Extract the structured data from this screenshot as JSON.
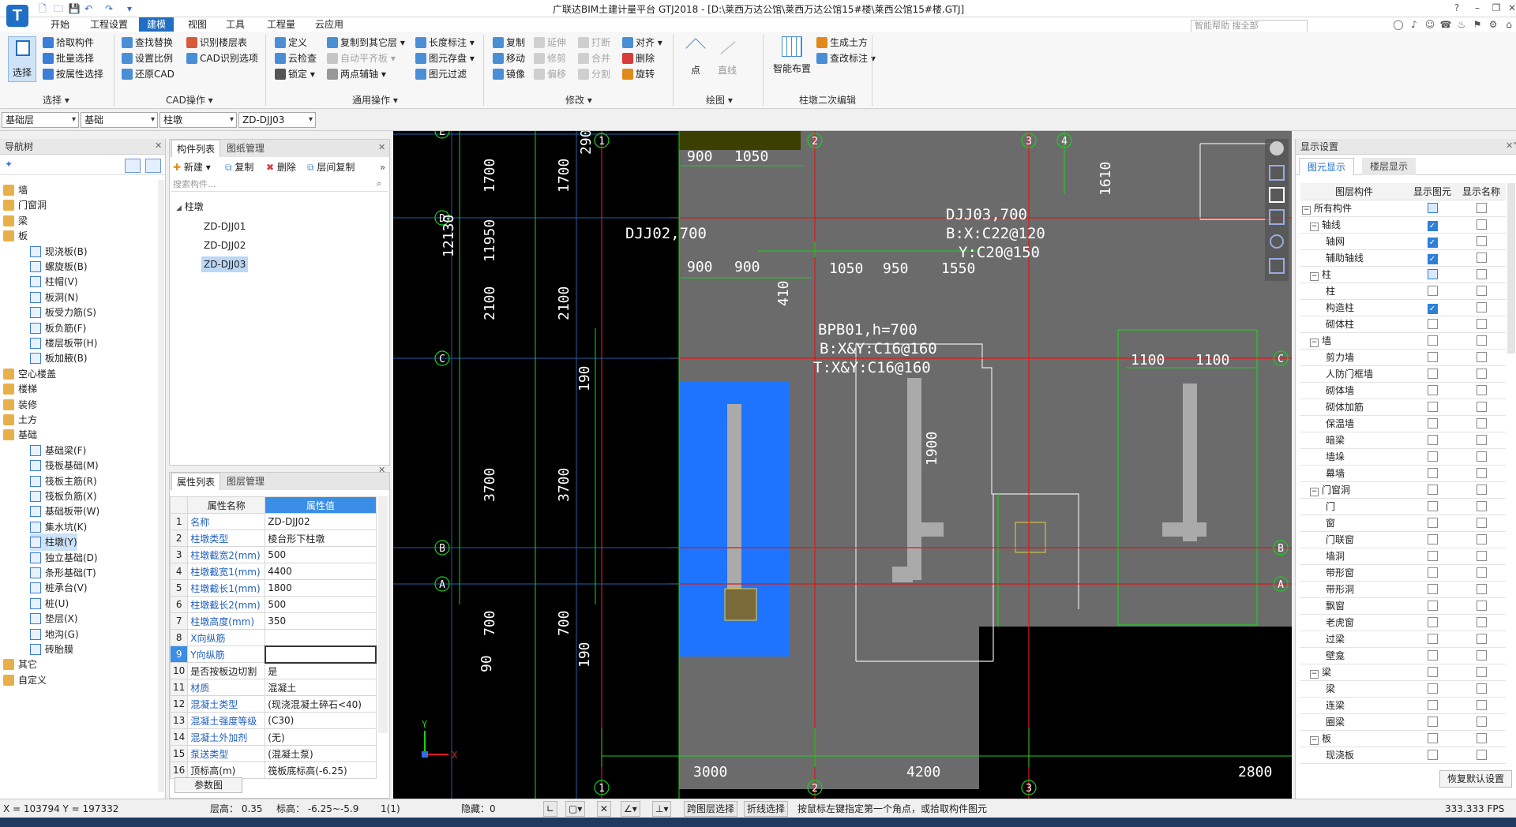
{
  "app": {
    "logo": "T",
    "title": "广联达BIM土建计量平台 GTJ2018 - [D:\\莱西万达公馆\\莱西万达公馆15#楼\\莱西公馆15#楼.GTJ]"
  },
  "menu": {
    "tabs": [
      "开始",
      "工程设置",
      "建模",
      "视图",
      "工具",
      "工程量",
      "云应用"
    ],
    "active_tab": "建模",
    "search_placeholder": "智能帮助 搜全部"
  },
  "ribbon": {
    "select": {
      "big_label": "选择",
      "items": [
        "拾取构件",
        "批量选择",
        "按属性选择"
      ],
      "group": "选择"
    },
    "cad": {
      "items": [
        "查找替换",
        "识别楼层表",
        "设置比例",
        "CAD识别选项",
        "还原CAD"
      ],
      "group": "CAD操作"
    },
    "common": {
      "items": [
        "定义",
        "复制到其它层",
        "长度标注",
        "云检查",
        "自动平齐板",
        "图元存盘",
        "锁定",
        "两点辅轴",
        "图元过滤"
      ],
      "group": "通用操作"
    },
    "modify": {
      "items": [
        "复制",
        "延伸",
        "打断",
        "对齐",
        "移动",
        "修剪",
        "合并",
        "删除",
        "镜像",
        "偏移",
        "分割",
        "旋转"
      ],
      "group": "修改"
    },
    "draw": {
      "items": [
        "点",
        "直线"
      ],
      "group": "绘图"
    },
    "smart": {
      "big_label": "智能布置",
      "items": [
        "生成土方",
        "查改标注"
      ],
      "group": "柱墩二次编辑"
    }
  },
  "selectors": [
    "基础层",
    "基础",
    "柱墩",
    "ZD-DJJ03"
  ],
  "nav": {
    "title": "导航树",
    "items": [
      {
        "label": "墙",
        "type": "folder"
      },
      {
        "label": "门窗洞",
        "type": "folder"
      },
      {
        "label": "梁",
        "type": "folder"
      },
      {
        "label": "板",
        "type": "folder-open"
      },
      {
        "label": "现浇板(B)",
        "type": "child"
      },
      {
        "label": "螺旋板(B)",
        "type": "child"
      },
      {
        "label": "柱帽(V)",
        "type": "child"
      },
      {
        "label": "板洞(N)",
        "type": "child"
      },
      {
        "label": "板受力筋(S)",
        "type": "child"
      },
      {
        "label": "板负筋(F)",
        "type": "child"
      },
      {
        "label": "楼层板带(H)",
        "type": "child"
      },
      {
        "label": "板加腋(B)",
        "type": "child"
      },
      {
        "label": "空心楼盖",
        "type": "folder"
      },
      {
        "label": "楼梯",
        "type": "folder"
      },
      {
        "label": "装修",
        "type": "folder"
      },
      {
        "label": "土方",
        "type": "folder"
      },
      {
        "label": "基础",
        "type": "folder-open"
      },
      {
        "label": "基础梁(F)",
        "type": "child"
      },
      {
        "label": "筏板基础(M)",
        "type": "child"
      },
      {
        "label": "筏板主筋(R)",
        "type": "child"
      },
      {
        "label": "筏板负筋(X)",
        "type": "child"
      },
      {
        "label": "基础板带(W)",
        "type": "child"
      },
      {
        "label": "集水坑(K)",
        "type": "child"
      },
      {
        "label": "柱墩(Y)",
        "type": "child-selected"
      },
      {
        "label": "独立基础(D)",
        "type": "child"
      },
      {
        "label": "条形基础(T)",
        "type": "child"
      },
      {
        "label": "桩承台(V)",
        "type": "child"
      },
      {
        "label": "桩(U)",
        "type": "child"
      },
      {
        "label": "垫层(X)",
        "type": "child"
      },
      {
        "label": "地沟(G)",
        "type": "child"
      },
      {
        "label": "砖胎膜",
        "type": "child"
      },
      {
        "label": "其它",
        "type": "folder"
      },
      {
        "label": "自定义",
        "type": "folder"
      }
    ]
  },
  "components": {
    "tabs": [
      "构件列表",
      "图纸管理"
    ],
    "actions": [
      "新建",
      "复制",
      "删除",
      "层间复制"
    ],
    "search_placeholder": "搜索构件...",
    "root": "柱墩",
    "items": [
      "ZD-DJJ01",
      "ZD-DJJ02",
      "ZD-DJJ03"
    ],
    "selected": "ZD-DJJ03"
  },
  "properties": {
    "tabs": [
      "属性列表",
      "图层管理"
    ],
    "headers": [
      "属性名称",
      "属性值"
    ],
    "rows": [
      {
        "n": "1",
        "name": "名称",
        "value": "ZD-DJJ02",
        "blue": true
      },
      {
        "n": "2",
        "name": "柱墩类型",
        "value": "棱台形下柱墩",
        "blue": true
      },
      {
        "n": "3",
        "name": "柱墩截宽2(mm)",
        "value": "500",
        "blue": true
      },
      {
        "n": "4",
        "name": "柱墩截宽1(mm)",
        "value": "4400",
        "blue": true
      },
      {
        "n": "5",
        "name": "柱墩截长1(mm)",
        "value": "1800",
        "blue": true
      },
      {
        "n": "6",
        "name": "柱墩截长2(mm)",
        "value": "500",
        "blue": true
      },
      {
        "n": "7",
        "name": "柱墩高度(mm)",
        "value": "350",
        "blue": true
      },
      {
        "n": "8",
        "name": "X向纵筋",
        "value": "",
        "blue": true
      },
      {
        "n": "9",
        "name": "Y向纵筋",
        "value": "",
        "blue": true
      },
      {
        "n": "10",
        "name": "是否按板边切割",
        "value": "是",
        "blue": false
      },
      {
        "n": "11",
        "name": "材质",
        "value": "混凝土",
        "blue": true
      },
      {
        "n": "12",
        "name": "混凝土类型",
        "value": "(现浇混凝土碎石<40)",
        "blue": true
      },
      {
        "n": "13",
        "name": "混凝土强度等级",
        "value": "(C30)",
        "blue": true
      },
      {
        "n": "14",
        "name": "混凝土外加剂",
        "value": "(无)",
        "blue": true
      },
      {
        "n": "15",
        "name": "泵送类型",
        "value": "(混凝土泵)",
        "blue": true
      },
      {
        "n": "16",
        "name": "顶标高(m)",
        "value": "筏板底标高(-6.25)",
        "blue": false
      }
    ],
    "footer_button": "参数图"
  },
  "drawing": {
    "axis_bubbles": [
      "1",
      "2",
      "3",
      "4",
      "A",
      "B",
      "C",
      "D",
      "E"
    ],
    "dims": [
      "290",
      "1700",
      "1700",
      "12130",
      "11950",
      "2100",
      "2100",
      "190",
      "3700",
      "3700",
      "700",
      "700",
      "90",
      "190",
      "900",
      "1050",
      "900",
      "900",
      "1050",
      "950",
      "1550",
      "410",
      "1610",
      "1100",
      "1100",
      "1900",
      "3000",
      "4200",
      "2800"
    ],
    "annotations": [
      "DJJ02,700",
      "DJJ03,700",
      "B:X:C22@120",
      "Y:C20@150",
      "BPB01,h=700",
      "B:X&Y:C16@160",
      "T:X&Y:C16@160"
    ]
  },
  "display": {
    "title": "显示设置",
    "tabs": [
      "图元显示",
      "楼层显示"
    ],
    "headers": [
      "图层构件",
      "显示图元",
      "显示名称"
    ],
    "rows": [
      {
        "label": "所有构件",
        "level": 0,
        "expand": "-",
        "show": "part",
        "name": false
      },
      {
        "label": "轴线",
        "level": 1,
        "expand": "-",
        "show": "on",
        "name": false
      },
      {
        "label": "轴网",
        "level": 2,
        "expand": "",
        "show": "on",
        "name": false
      },
      {
        "label": "辅助轴线",
        "level": 2,
        "expand": "",
        "show": "on",
        "name": false
      },
      {
        "label": "柱",
        "level": 1,
        "expand": "-",
        "show": "part",
        "name": false
      },
      {
        "label": "柱",
        "level": 2,
        "expand": "",
        "show": "off",
        "name": false
      },
      {
        "label": "构造柱",
        "level": 2,
        "expand": "",
        "show": "on",
        "name": false
      },
      {
        "label": "砌体柱",
        "level": 2,
        "expand": "",
        "show": "off",
        "name": false
      },
      {
        "label": "墙",
        "level": 1,
        "expand": "-",
        "show": "off",
        "name": false
      },
      {
        "label": "剪力墙",
        "level": 2,
        "expand": "",
        "show": "off",
        "name": false
      },
      {
        "label": "人防门框墙",
        "level": 2,
        "expand": "",
        "show": "off",
        "name": false
      },
      {
        "label": "砌体墙",
        "level": 2,
        "expand": "",
        "show": "off",
        "name": false
      },
      {
        "label": "砌体加筋",
        "level": 2,
        "expand": "",
        "show": "off",
        "name": false
      },
      {
        "label": "保温墙",
        "level": 2,
        "expand": "",
        "show": "off",
        "name": false
      },
      {
        "label": "暗梁",
        "level": 2,
        "expand": "",
        "show": "off",
        "name": false
      },
      {
        "label": "墙垛",
        "level": 2,
        "expand": "",
        "show": "off",
        "name": false
      },
      {
        "label": "幕墙",
        "level": 2,
        "expand": "",
        "show": "off",
        "name": false
      },
      {
        "label": "门窗洞",
        "level": 1,
        "expand": "-",
        "show": "off",
        "name": false
      },
      {
        "label": "门",
        "level": 2,
        "expand": "",
        "show": "off",
        "name": false
      },
      {
        "label": "窗",
        "level": 2,
        "expand": "",
        "show": "off",
        "name": false
      },
      {
        "label": "门联窗",
        "level": 2,
        "expand": "",
        "show": "off",
        "name": false
      },
      {
        "label": "墙洞",
        "level": 2,
        "expand": "",
        "show": "off",
        "name": false
      },
      {
        "label": "带形窗",
        "level": 2,
        "expand": "",
        "show": "off",
        "name": false
      },
      {
        "label": "带形洞",
        "level": 2,
        "expand": "",
        "show": "off",
        "name": false
      },
      {
        "label": "飘窗",
        "level": 2,
        "expand": "",
        "show": "off",
        "name": false
      },
      {
        "label": "老虎窗",
        "level": 2,
        "expand": "",
        "show": "off",
        "name": false
      },
      {
        "label": "过梁",
        "level": 2,
        "expand": "",
        "show": "off",
        "name": false
      },
      {
        "label": "壁龛",
        "level": 2,
        "expand": "",
        "show": "off",
        "name": false
      },
      {
        "label": "梁",
        "level": 1,
        "expand": "-",
        "show": "off",
        "name": false
      },
      {
        "label": "梁",
        "level": 2,
        "expand": "",
        "show": "off",
        "name": false
      },
      {
        "label": "连梁",
        "level": 2,
        "expand": "",
        "show": "off",
        "name": false
      },
      {
        "label": "圈梁",
        "level": 2,
        "expand": "",
        "show": "off",
        "name": false
      },
      {
        "label": "板",
        "level": 1,
        "expand": "-",
        "show": "off",
        "name": false
      },
      {
        "label": "现浇板",
        "level": 2,
        "expand": "",
        "show": "off",
        "name": false
      }
    ],
    "reset_button": "恢复默认设置"
  },
  "status": {
    "coords": "X = 103794 Y = 197332",
    "floor_height": "层高： 0.35",
    "elevation": "标高： -6.25~-5.9",
    "count": "1(1)",
    "hidden": "隐藏：0",
    "btn_cross_layer": "跨图层选择",
    "btn_polyline": "折线选择",
    "hint": "按鼠标左键指定第一个角点，或拾取构件图元",
    "fps": "333.333 FPS"
  },
  "colors": {
    "accent": "#1f6fc5",
    "canvas_bg": "#000000",
    "axis_red": "#e01818",
    "dim_green": "#19d119",
    "highlight_blue": "#1f74ff",
    "slab_gray": "#6b6b6b"
  }
}
